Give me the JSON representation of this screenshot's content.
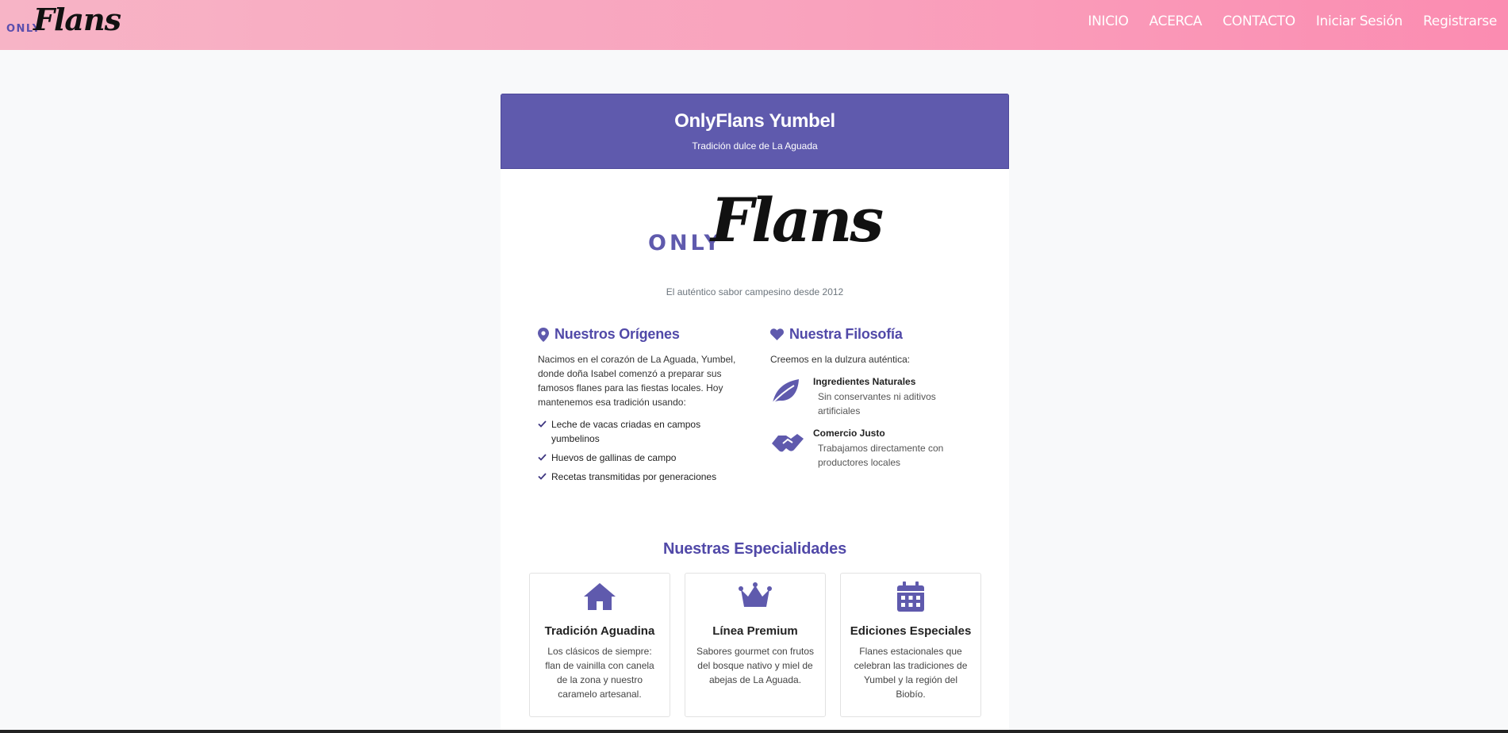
{
  "navbar": {
    "brand_only": "ONLY",
    "brand_flans": "Flans",
    "links": [
      "INICIO",
      "ACERCA",
      "CONTACTO",
      "Iniciar Sesión",
      "Registrarse"
    ]
  },
  "header": {
    "title": "OnlyFlans Yumbel",
    "subtitle": "Tradición dulce de La Aguada"
  },
  "logo": {
    "only": "ONLY",
    "flans": "Flans"
  },
  "tagline": "El auténtico sabor campesino desde 2012",
  "origins": {
    "title": "Nuestros Orígenes",
    "icon": "map-marker-icon",
    "text": "Nacimos en el corazón de La Aguada, Yumbel, donde doña Isabel comenzó a preparar sus famosos flanes para las fiestas locales. Hoy mantenemos esa tradición usando:",
    "items": [
      "Leche de vacas criadas en campos yumbelinos",
      "Huevos de gallinas de campo",
      "Recetas transmitidas por generaciones"
    ]
  },
  "philosophy": {
    "title": "Nuestra Filosofía",
    "icon": "heart-icon",
    "intro": "Creemos en la dulzura auténtica:",
    "features": [
      {
        "icon": "leaf-icon",
        "title": "Ingredientes Naturales",
        "desc": "Sin conservantes ni aditivos artificiales"
      },
      {
        "icon": "handshake-icon",
        "title": "Comercio Justo",
        "desc": "Trabajamos directamente con productores locales"
      }
    ]
  },
  "specialties": {
    "title": "Nuestras Especialidades",
    "items": [
      {
        "icon": "house-icon",
        "name": "Tradición Aguadina",
        "desc": "Los clásicos de siempre: flan de vainilla con canela de la zona y nuestro caramelo artesanal."
      },
      {
        "icon": "crown-icon",
        "name": "Línea Premium",
        "desc": "Sabores gourmet con frutos del bosque nativo y miel de abejas de La Aguada."
      },
      {
        "icon": "calendar-icon",
        "name": "Ediciones Especiales",
        "desc": "Flanes estacionales que celebran las tradiciones de Yumbel y la región del Biobío."
      }
    ]
  },
  "colors": {
    "accent": "#5f5aad",
    "navbar_start": "#f7b4c6",
    "navbar_end": "#fb8cb1"
  }
}
